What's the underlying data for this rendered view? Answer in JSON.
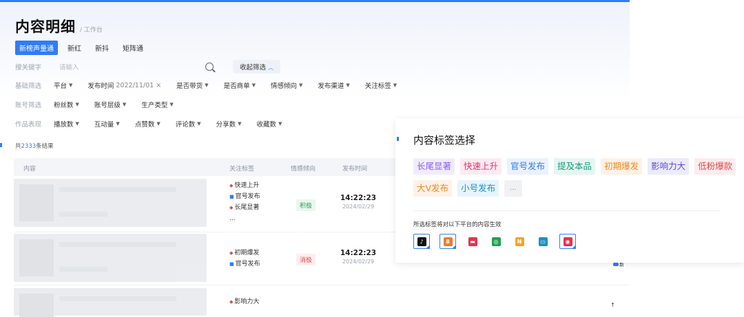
{
  "page": {
    "title": "内容明细",
    "subtitle": "/ 工作台"
  },
  "tabs": [
    {
      "label": "新榜声量通",
      "active": true
    },
    {
      "label": "新红",
      "active": false
    },
    {
      "label": "新抖",
      "active": false
    },
    {
      "label": "矩阵通",
      "active": false
    }
  ],
  "filters": {
    "keyword_label": "搜关键字",
    "search_placeholder": "请输入",
    "collapse_label": "收起筛选",
    "basic_label": "基础筛选",
    "basic": [
      "平台",
      "发布时间",
      "是否带货",
      "是否商单",
      "情感倾向",
      "发布渠道",
      "关注标签"
    ],
    "publish_time_value": "2022/11/01",
    "publish_time_clear": "×",
    "account_label": "账号筛选",
    "account": [
      "粉丝数",
      "账号层级",
      "生产类型"
    ],
    "work_label": "作品表现",
    "work": [
      "播放数",
      "互动量",
      "点赞数",
      "评论数",
      "分享数",
      "收藏数"
    ]
  },
  "results": {
    "prefix": "共",
    "count": "2333",
    "suffix": "条结果"
  },
  "table": {
    "headers": {
      "content": "内容",
      "tags": "关注标签",
      "sentiment": "情感倾向",
      "time": "发布时间"
    },
    "rows": [
      {
        "tags": [
          {
            "label": "快速上升",
            "kind": "red"
          },
          {
            "label": "官号发布",
            "kind": "blue"
          },
          {
            "label": "长尾显著",
            "kind": "red"
          },
          {
            "label": "...",
            "kind": "none"
          }
        ],
        "sentiment": "积极",
        "sentiment_type": "pos",
        "time": "14:22:23",
        "date": "2024/02/29"
      },
      {
        "tags": [
          {
            "label": "初期爆发",
            "kind": "red"
          },
          {
            "label": "官号发布",
            "kind": "blue"
          }
        ],
        "sentiment": "消极",
        "sentiment_type": "neg",
        "time": "14:22:23",
        "date": "2024/02/29"
      },
      {
        "tags": [
          {
            "label": "影响力大",
            "kind": "red"
          }
        ],
        "sentiment": "",
        "sentiment_type": "",
        "time": "",
        "date": ""
      }
    ]
  },
  "edge": {
    "badge_text": "新",
    "arrow_text": "↑"
  },
  "panel": {
    "title": "内容标签选择",
    "tags": [
      {
        "label": "长尾显著",
        "color": "#8a5cf6",
        "bg": "#f1ecfd"
      },
      {
        "label": "快速上升",
        "color": "#e5336a",
        "bg": "#fdebf1"
      },
      {
        "label": "官号发布",
        "color": "#2f7cf6",
        "bg": "#eaf2fe"
      },
      {
        "label": "提及本品",
        "color": "#1a9c7a",
        "bg": "#e6f6f1"
      },
      {
        "label": "初期爆发",
        "color": "#f08a24",
        "bg": "#fef2e6"
      },
      {
        "label": "影响力大",
        "color": "#5b4bdb",
        "bg": "#ecebfb"
      },
      {
        "label": "低粉爆款",
        "color": "#e5484d",
        "bg": "#fdeced"
      },
      {
        "label": "大V发布",
        "color": "#f08a24",
        "bg": "#fef2e6"
      },
      {
        "label": "小号发布",
        "color": "#1f90c6",
        "bg": "#e7f4fb"
      }
    ],
    "more_label": "...",
    "platform_note": "所选标签将对以下平台的内容生效",
    "platforms": [
      {
        "icon": "douyin-icon",
        "color": "#111111",
        "glyph": "♪",
        "selected": true
      },
      {
        "icon": "xiaohongshu-icon",
        "color": "#f07a2b",
        "glyph": "8",
        "selected": true
      },
      {
        "icon": "weibo-red-icon",
        "color": "#e5334a",
        "glyph": "▬",
        "selected": false
      },
      {
        "icon": "wechat-icon",
        "color": "#21a053",
        "glyph": "◎",
        "selected": false
      },
      {
        "icon": "kuaishou-icon",
        "color": "#f5a623",
        "glyph": "N",
        "selected": false
      },
      {
        "icon": "bilibili-icon",
        "color": "#1f90c6",
        "glyph": "▭",
        "selected": false
      },
      {
        "icon": "weibo-icon",
        "color": "#e5334a",
        "glyph": "◉",
        "selected": true
      }
    ]
  }
}
